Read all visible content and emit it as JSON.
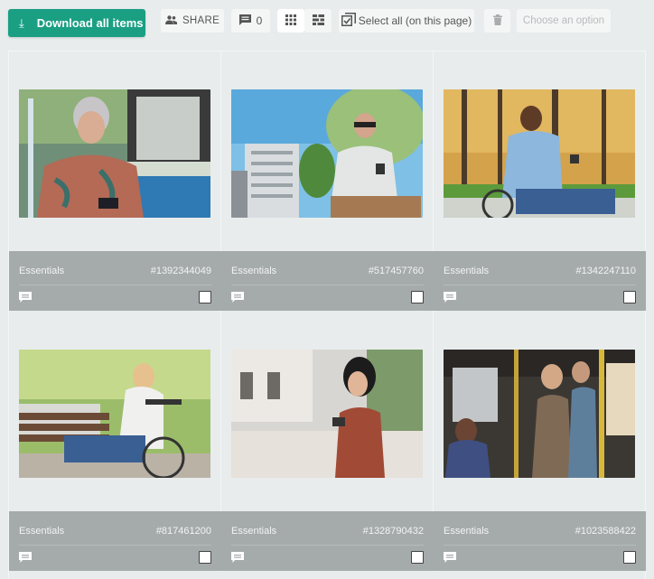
{
  "toolbar": {
    "download_label": "Download all items",
    "download_icon": "download-arrow-icon",
    "share_label": "SHARE",
    "share_icon": "people-icon",
    "comments_count": "0",
    "comments_icon": "comment-icon",
    "grid_view_icon": "grid-view-icon",
    "list_view_icon": "masonry-view-icon",
    "select_all_label": "Select all (on this page)",
    "select_all_icon": "select-all-checkbox-icon",
    "delete_icon": "trash-icon",
    "choose_option_placeholder": "Choose an option",
    "accent_color": "#1a9f83"
  },
  "items": [
    {
      "collection": "Essentials",
      "id": "#1392344049",
      "photo": "older woman with white hair looking at smartphone by a pool",
      "checked": false
    },
    {
      "collection": "Essentials",
      "id": "#517457760",
      "photo": "older man in sunglasses sitting using smartphone under a tree near a building",
      "checked": false
    },
    {
      "collection": "Essentials",
      "id": "#1342247110",
      "photo": "man in wheelchair using smartphone in an autumn park",
      "checked": false
    },
    {
      "collection": "Essentials",
      "id": "#817461200",
      "photo": "young woman in wheelchair using smartphone in a park next to a bench",
      "checked": false
    },
    {
      "collection": "Essentials",
      "id": "#1328790432",
      "photo": "young woman with earphones looking at smartphone on a street",
      "checked": false
    },
    {
      "collection": "Essentials",
      "id": "#1023588422",
      "photo": "passengers standing on a bus looking at smartphones",
      "checked": false
    }
  ]
}
